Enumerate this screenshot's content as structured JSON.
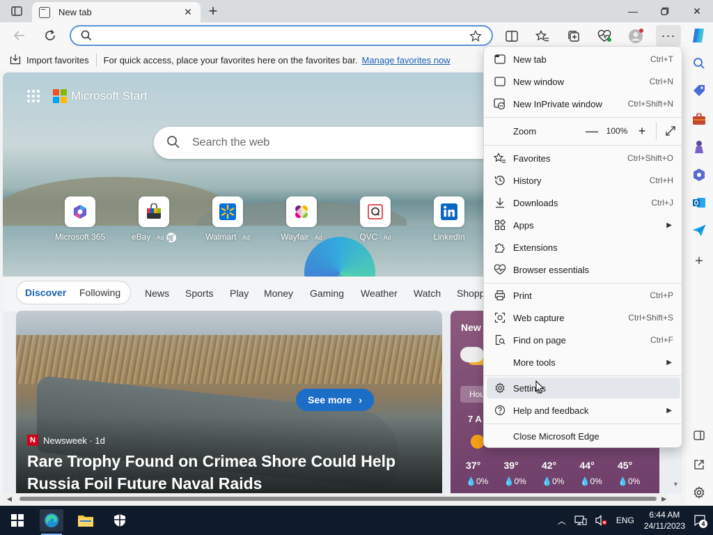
{
  "tab": {
    "title": "New tab"
  },
  "favorites_bar": {
    "import_label": "Import favorites",
    "hint": "For quick access, place your favorites here on the favorites bar.",
    "manage_link": "Manage favorites now"
  },
  "page": {
    "brand": "Microsoft Start",
    "search_placeholder": "Search the web",
    "quick_links": [
      {
        "label": "Microsoft 365",
        "ad": ""
      },
      {
        "label": "eBay",
        "ad": "· Ad"
      },
      {
        "label": "Walmart",
        "ad": "· Ad"
      },
      {
        "label": "Wayfair",
        "ad": "· Ad"
      },
      {
        "label": "QVC",
        "ad": "· Ad"
      },
      {
        "label": "LinkedIn",
        "ad": ""
      }
    ],
    "feed_tabs": {
      "discover": "Discover",
      "following": "Following",
      "items": [
        "News",
        "Sports",
        "Play",
        "Money",
        "Gaming",
        "Weather",
        "Watch",
        "Shopp"
      ]
    },
    "news": {
      "source": "Newsweek · 1d",
      "source_logo": "N",
      "title": "Rare Trophy Found on Crimea Shore Could Help Russia Foil Future Naval Raids",
      "see_more": "See more"
    },
    "weather": {
      "title": "New",
      "hourly_tab": "Hou",
      "time": "7 A",
      "temps": [
        "37°",
        "39°",
        "42°",
        "44°",
        "45°"
      ],
      "precip": [
        "0%",
        "0%",
        "0%",
        "0%",
        "0%"
      ]
    }
  },
  "menu": {
    "items": [
      {
        "label": "New tab",
        "shortcut": "Ctrl+T"
      },
      {
        "label": "New window",
        "shortcut": "Ctrl+N"
      },
      {
        "label": "New InPrivate window",
        "shortcut": "Ctrl+Shift+N"
      },
      {
        "label": "Favorites",
        "shortcut": "Ctrl+Shift+O"
      },
      {
        "label": "History",
        "shortcut": "Ctrl+H"
      },
      {
        "label": "Downloads",
        "shortcut": "Ctrl+J"
      },
      {
        "label": "Apps",
        "shortcut": ""
      },
      {
        "label": "Extensions",
        "shortcut": ""
      },
      {
        "label": "Browser essentials",
        "shortcut": ""
      },
      {
        "label": "Print",
        "shortcut": "Ctrl+P"
      },
      {
        "label": "Web capture",
        "shortcut": "Ctrl+Shift+S"
      },
      {
        "label": "Find on page",
        "shortcut": "Ctrl+F"
      },
      {
        "label": "More tools",
        "shortcut": ""
      },
      {
        "label": "Settings",
        "shortcut": ""
      },
      {
        "label": "Help and feedback",
        "shortcut": ""
      },
      {
        "label": "Close Microsoft Edge",
        "shortcut": ""
      }
    ],
    "zoom": {
      "label": "Zoom",
      "value": "100%"
    }
  },
  "taskbar": {
    "language": "ENG",
    "time": "6:44 AM",
    "date": "24/11/2023",
    "notifications": "4"
  },
  "colors": {
    "accent": "#1a5fb4",
    "address_border": "#5b8fd8",
    "taskbar": "#0f1a2b",
    "see_more": "#1c6dc6"
  }
}
